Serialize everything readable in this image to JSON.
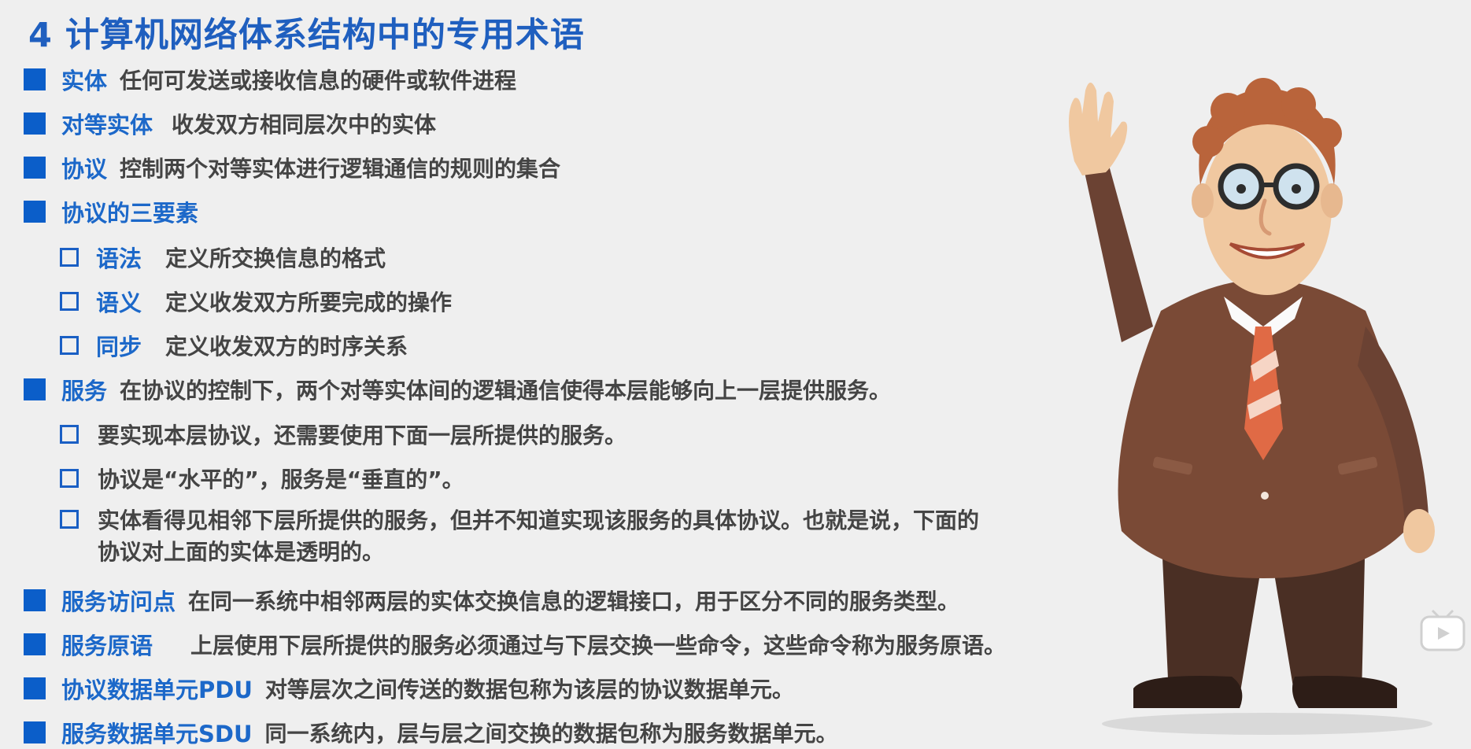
{
  "slide": {
    "title": "4 计算机网络体系结构中的专用术语",
    "items": [
      {
        "term": "实体",
        "desc": "任何可发送或接收信息的硬件或软件进程"
      },
      {
        "term": "对等实体",
        "desc": "收发双方相同层次中的实体"
      },
      {
        "term": "协议",
        "desc": "控制两个对等实体进行逻辑通信的规则的集合"
      },
      {
        "term": "协议的三要素",
        "desc": ""
      },
      {
        "term": "语法",
        "desc": "定义所交换信息的格式"
      },
      {
        "term": "语义",
        "desc": "定义收发双方所要完成的操作"
      },
      {
        "term": "同步",
        "desc": "定义收发双方的时序关系"
      },
      {
        "term": "服务",
        "desc": "在协议的控制下，两个对等实体间的逻辑通信使得本层能够向上一层提供服务。"
      },
      {
        "term": "",
        "desc": "要实现本层协议，还需要使用下面一层所提供的服务。"
      },
      {
        "term": "",
        "desc": "协议是“水平的”，服务是“垂直的”。"
      },
      {
        "term": "",
        "desc": "实体看得见相邻下层所提供的服务，但并不知道实现该服务的具体协议。也就是说，下面的协议对上面的实体是透明的。"
      },
      {
        "term": "服务访问点",
        "desc": "在同一系统中相邻两层的实体交换信息的逻辑接口，用于区分不同的服务类型。"
      },
      {
        "term": "服务原语",
        "desc": "上层使用下层所提供的服务必须通过与下层交换一些命令，这些命令称为服务原语。"
      },
      {
        "term": "协议数据单元PDU",
        "desc": "对等层次之间传送的数据包称为该层的协议数据单元。"
      },
      {
        "term": "服务数据单元SDU",
        "desc": "同一系统内，层与层之间交换的数据包称为服务数据单元。"
      }
    ]
  },
  "colors": {
    "title": "#1f5fbf",
    "term": "#1c68c9",
    "bullet": "#0b5ec9",
    "text": "#444444",
    "background": "#efefef"
  },
  "icons": {
    "character": "cartoon-man-waving",
    "watermark": "bilibili-tv-icon"
  }
}
